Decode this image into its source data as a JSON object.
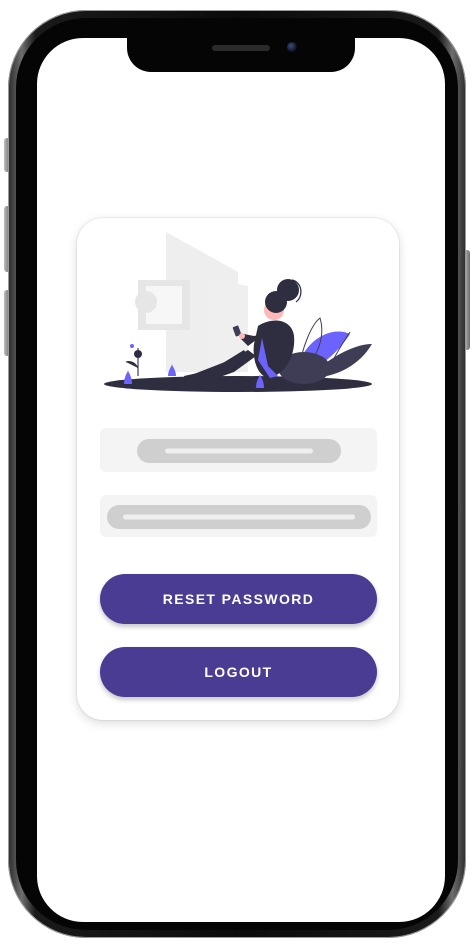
{
  "buttons": {
    "reset_password_label": "RESET PASSWORD",
    "logout_label": "LOGOUT"
  },
  "icons": {
    "illustration": "woman-sitting-with-phone-illustration"
  },
  "colors": {
    "accent": "#4a3c93",
    "illustration_accent": "#6c63ff",
    "field_background": "#f4f4f4",
    "placeholder_bar": "#cfcfcf"
  }
}
